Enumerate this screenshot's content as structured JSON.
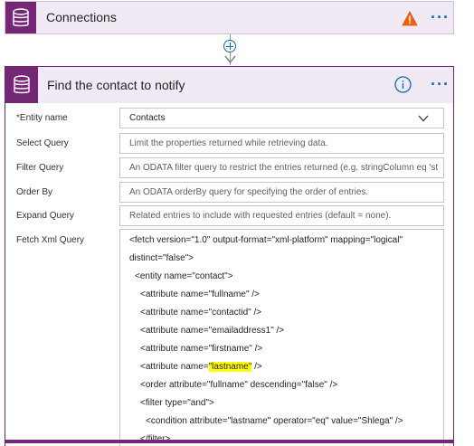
{
  "connections_card": {
    "title": "Connections",
    "icons": [
      "database-icon",
      "warning-icon",
      "more-icon"
    ],
    "more_label": "···"
  },
  "add_step": {
    "icon": "plus-circle-icon"
  },
  "action_card": {
    "title": "Find the contact to notify",
    "icons": [
      "database-icon",
      "info-icon",
      "more-icon"
    ],
    "more_label": "···",
    "fields": {
      "entity_name": {
        "label": "Entity name",
        "required_mark": "*",
        "value": "Contacts"
      },
      "select_query": {
        "label": "Select Query",
        "placeholder": "Limit the properties returned while retrieving data."
      },
      "filter_query": {
        "label": "Filter Query",
        "placeholder": "An ODATA filter query to restrict the entries returned (e.g. stringColumn eq 'st"
      },
      "order_by": {
        "label": "Order By",
        "placeholder": "An ODATA orderBy query for specifying the order of entries."
      },
      "expand_query": {
        "label": "Expand Query",
        "placeholder": "Related entries to include with requested entries (default = none)."
      },
      "fetch_xml": {
        "label": "Fetch Xml Query",
        "lines": [
          "<fetch version=\"1.0\" output-format=\"xml-platform\" mapping=\"logical\"",
          "distinct=\"false\">",
          "<entity name=\"contact\">",
          "<attribute name=\"fullname\" />",
          "<attribute name=\"contactid\" />",
          "<attribute name=\"emailaddress1\" />",
          "<attribute name=\"firstname\" />",
          "<attribute name=",
          "\"lastname\"",
          " />",
          "<order attribute=\"fullname\" descending=\"false\" />",
          "<filter type=\"and\">",
          "<condition attribute=\"lastname\" operator=\"eq\" value=\"Shlega\" />",
          "</filter>"
        ],
        "highlight_color": "#ffff00"
      }
    }
  },
  "colors": {
    "accent": "#742774",
    "card_header_bg": "#f1e9f3",
    "link_blue": "#0f6cbd",
    "warning": "#f7630c"
  }
}
